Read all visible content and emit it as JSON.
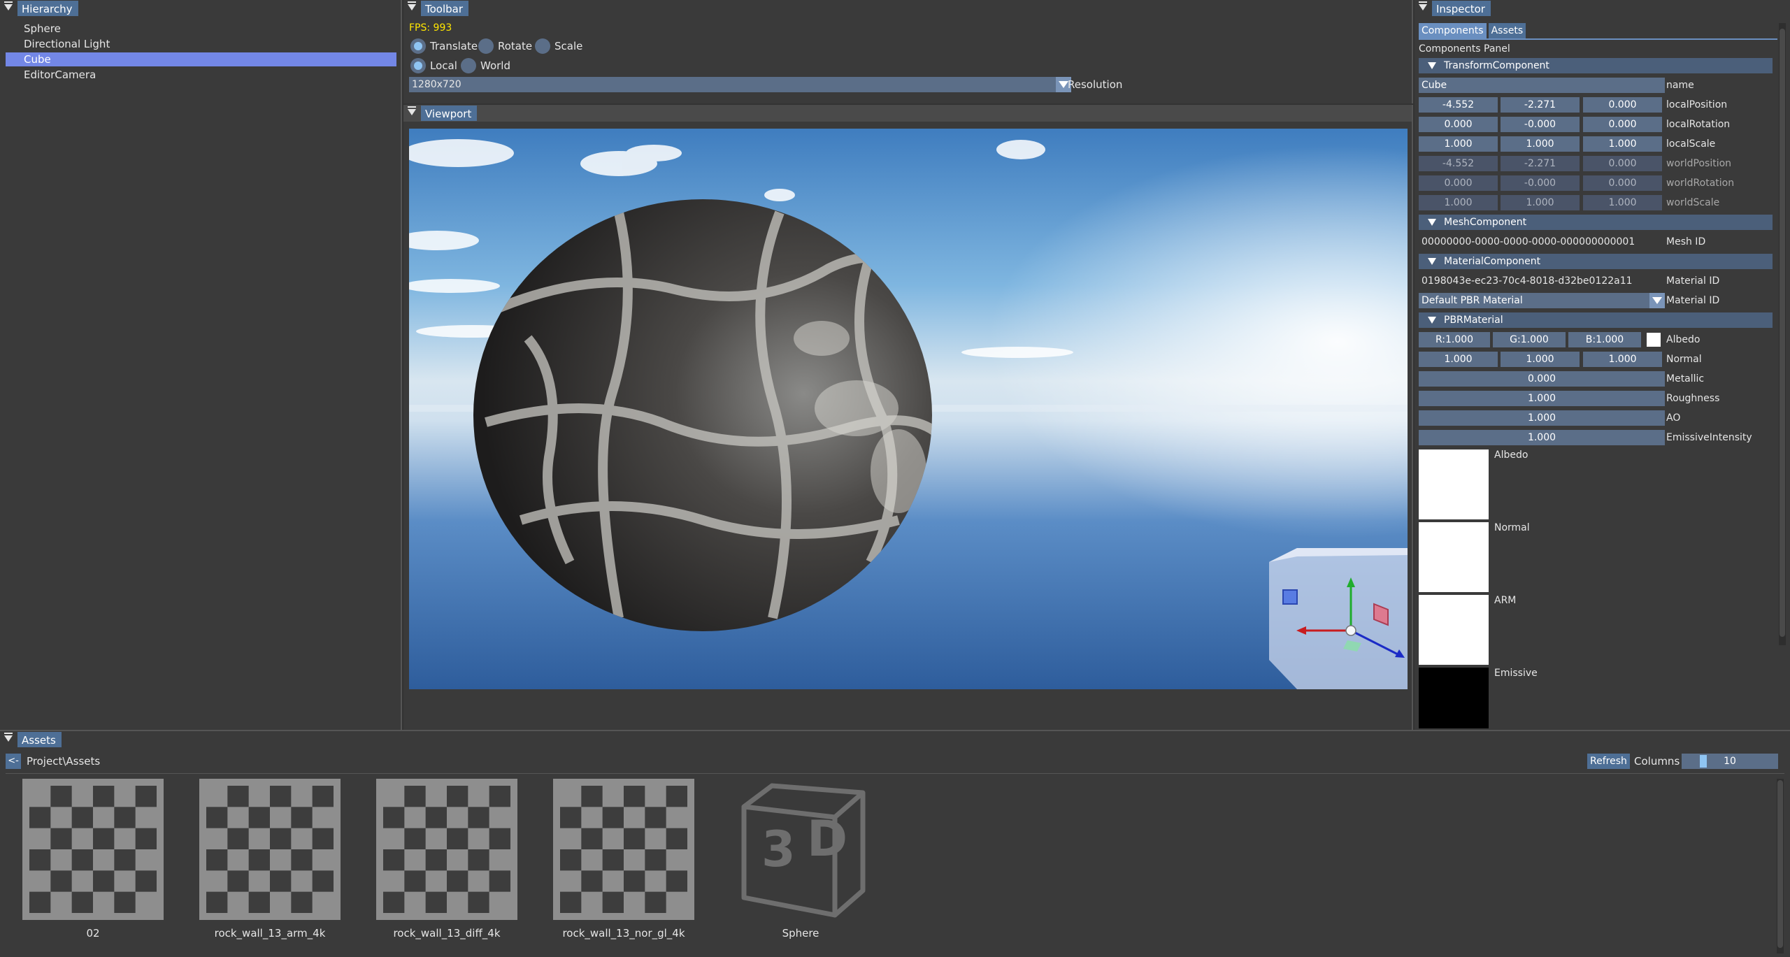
{
  "hierarchy": {
    "title": "Hierarchy",
    "items": [
      {
        "label": "Sphere",
        "selected": false
      },
      {
        "label": "Directional Light",
        "selected": false
      },
      {
        "label": "Cube",
        "selected": true
      },
      {
        "label": "EditorCamera",
        "selected": false
      }
    ]
  },
  "toolbar": {
    "title": "Toolbar",
    "fps": "FPS: 993",
    "gizmo_modes": [
      {
        "label": "Translate",
        "selected": true
      },
      {
        "label": "Rotate",
        "selected": false
      },
      {
        "label": "Scale",
        "selected": false
      }
    ],
    "spaces": [
      {
        "label": "Local",
        "selected": true
      },
      {
        "label": "World",
        "selected": false
      }
    ],
    "resolution_value": "1280x720",
    "resolution_label": "Resolution"
  },
  "viewport": {
    "title": "Viewport"
  },
  "inspector": {
    "title": "Inspector",
    "tabs": [
      {
        "label": "Components",
        "active": true
      },
      {
        "label": "Assets",
        "active": false
      }
    ],
    "panel_title": "Components Panel",
    "transform": {
      "header": "TransformComponent",
      "name_value": "Cube",
      "name_label": "name",
      "rows": [
        {
          "label": "localPosition",
          "values": [
            "-4.552",
            "-2.271",
            "0.000"
          ],
          "dim": false
        },
        {
          "label": "localRotation",
          "values": [
            "0.000",
            "-0.000",
            "0.000"
          ],
          "dim": false
        },
        {
          "label": "localScale",
          "values": [
            "1.000",
            "1.000",
            "1.000"
          ],
          "dim": false
        },
        {
          "label": "worldPosition",
          "values": [
            "-4.552",
            "-2.271",
            "0.000"
          ],
          "dim": true
        },
        {
          "label": "worldRotation",
          "values": [
            "0.000",
            "-0.000",
            "0.000"
          ],
          "dim": true
        },
        {
          "label": "worldScale",
          "values": [
            "1.000",
            "1.000",
            "1.000"
          ],
          "dim": true
        }
      ]
    },
    "mesh": {
      "header": "MeshComponent",
      "mesh_id": "00000000-0000-0000-0000-000000000001",
      "mesh_id_label": "Mesh ID"
    },
    "material": {
      "header": "MaterialComponent",
      "material_id": "0198043e-ec23-70c4-8018-d32be0122a11",
      "material_id_label": "Material ID",
      "material_select": "Default PBR Material",
      "material_select_label": "Material ID"
    },
    "pbr": {
      "header": "PBRMaterial",
      "albedo": [
        "R:1.000",
        "G:1.000",
        "B:1.000"
      ],
      "albedo_label": "Albedo",
      "albedo_color": "#ffffff",
      "normal": [
        "1.000",
        "1.000",
        "1.000"
      ],
      "normal_label": "Normal",
      "metallic": "0.000",
      "metallic_label": "Metallic",
      "roughness": "1.000",
      "roughness_label": "Roughness",
      "ao": "1.000",
      "ao_label": "AO",
      "emissive_intensity": "1.000",
      "emissive_intensity_label": "EmissiveIntensity",
      "textures": [
        {
          "label": "Albedo",
          "color": "#ffffff"
        },
        {
          "label": "Normal",
          "color": "#ffffff"
        },
        {
          "label": "ARM",
          "color": "#ffffff"
        },
        {
          "label": "Emissive",
          "color": "#000000"
        }
      ]
    }
  },
  "assets": {
    "title": "Assets",
    "back_label": "<-",
    "path": "Project\\Assets",
    "refresh_label": "Refresh",
    "columns_label": "Columns",
    "columns_value": "10",
    "columns_fraction": 0.2,
    "items": [
      {
        "name": "02",
        "icon": "texture-checker-icon"
      },
      {
        "name": "rock_wall_13_arm_4k",
        "icon": "texture-checker-icon"
      },
      {
        "name": "rock_wall_13_diff_4k",
        "icon": "texture-checker-icon"
      },
      {
        "name": "rock_wall_13_nor_gl_4k",
        "icon": "texture-checker-icon"
      },
      {
        "name": "Sphere",
        "icon": "3d-model-icon"
      }
    ]
  },
  "colors": {
    "accent": "#4e6f96",
    "selection": "#7387e6",
    "fps": "#ffe600"
  }
}
